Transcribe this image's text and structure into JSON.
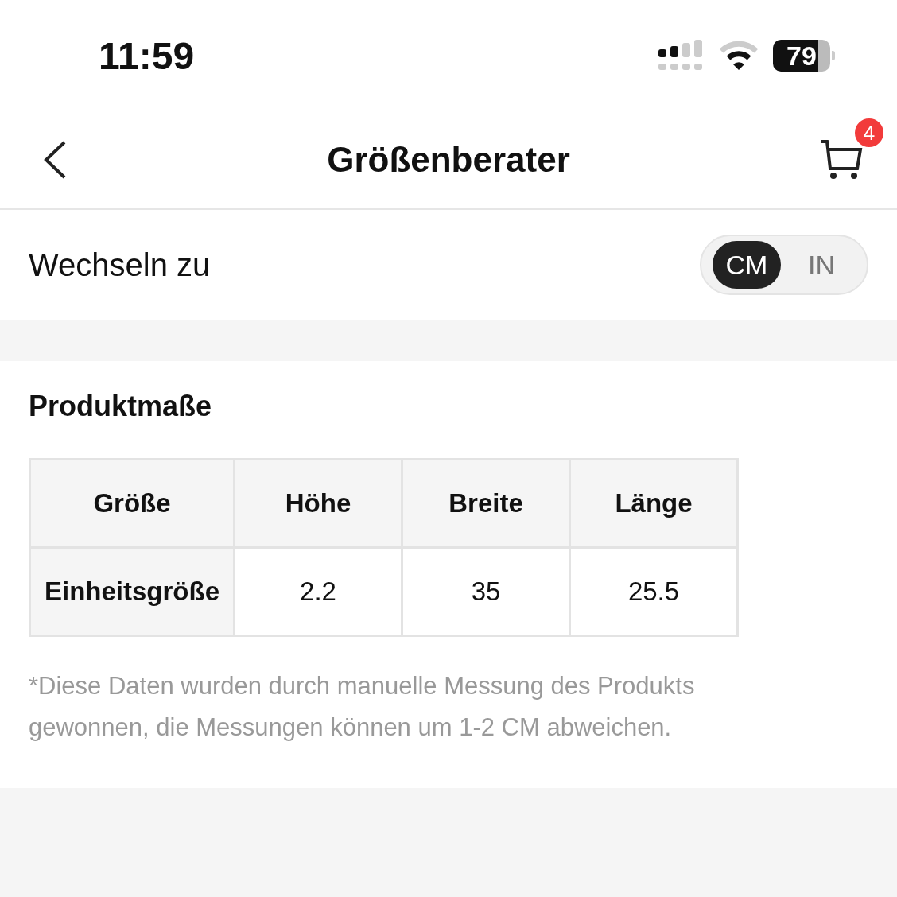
{
  "status_bar": {
    "time": "11:59",
    "battery": "79"
  },
  "header": {
    "title": "Größenberater",
    "cart_badge": "4"
  },
  "unit_switch": {
    "label": "Wechseln zu",
    "units": [
      {
        "label": "CM",
        "selected": true
      },
      {
        "label": "IN",
        "selected": false
      }
    ]
  },
  "product_dimensions": {
    "title": "Produktmaße",
    "table": {
      "columns": [
        "Größe",
        "Höhe",
        "Breite",
        "Länge"
      ],
      "rows": [
        [
          "Einheitsgröße",
          "2.2",
          "35",
          "25.5"
        ]
      ]
    },
    "note": "*Diese Daten wurden durch manuelle Messung des Produkts gewonnen, die Messungen können um 1-2 CM abweichen."
  }
}
